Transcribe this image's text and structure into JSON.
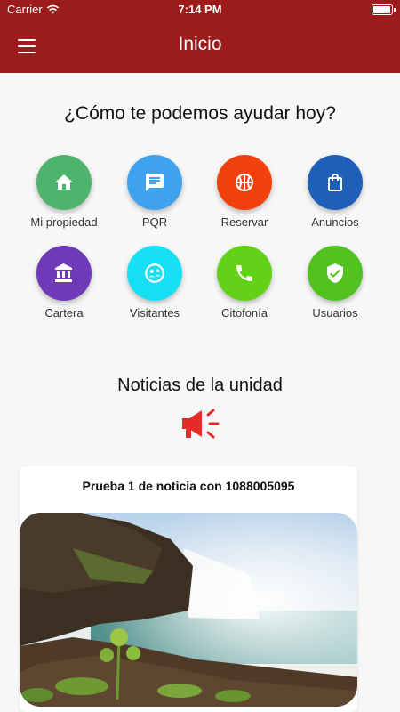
{
  "status_bar": {
    "carrier": "Carrier",
    "time": "7:14 PM"
  },
  "app_bar": {
    "title": "Inicio"
  },
  "help": {
    "title": "¿Cómo te podemos ayudar hoy?"
  },
  "actions": [
    {
      "label": "Mi propiedad",
      "icon": "home-icon",
      "color": "#4fb46b"
    },
    {
      "label": "PQR",
      "icon": "chat-icon",
      "color": "#3ea2ee"
    },
    {
      "label": "Reservar",
      "icon": "basketball-icon",
      "color": "#f0410d"
    },
    {
      "label": "Anuncios",
      "icon": "shopping-bag-icon",
      "color": "#1e5fb8"
    },
    {
      "label": "Cartera",
      "icon": "bank-icon",
      "color": "#6f3ab8"
    },
    {
      "label": "Visitantes",
      "icon": "visitor-icon",
      "color": "#18e0f4"
    },
    {
      "label": "Citofonía",
      "icon": "phone-icon",
      "color": "#62d117"
    },
    {
      "label": "Usuarios",
      "icon": "shield-check-icon",
      "color": "#51c220"
    }
  ],
  "news": {
    "title": "Noticias de la unidad",
    "icon": "megaphone-icon",
    "icon_color": "#e52a2a",
    "items": [
      {
        "title": "Prueba 1 de noticia con 1088005095",
        "image": "waterfall-image"
      }
    ]
  }
}
